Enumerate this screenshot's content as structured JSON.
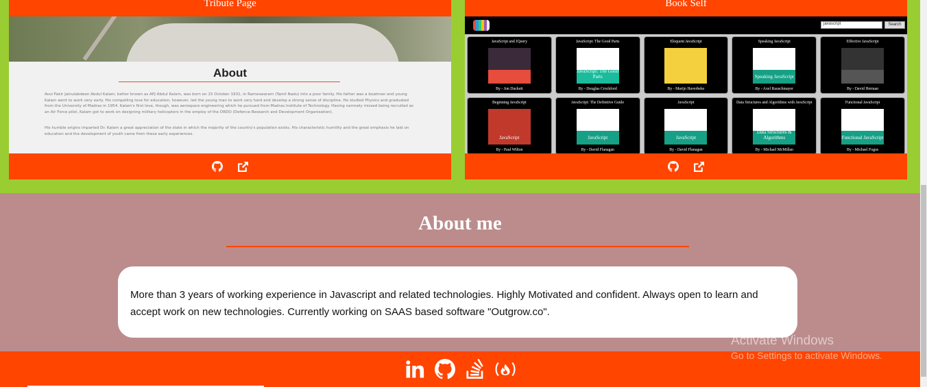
{
  "projects": [
    {
      "title": "Tribute Page",
      "preview": {
        "heading": "About",
        "paragraphs": [
          "Avul Pakir Jainulabdeen Abdul Kalam, better known as APJ Abdul Kalam, was born on 15 October 1931, in Rameswaram (Tamil Nadu) into a poor family. His father was a boatman and young Kalam went to work very early. His compelling love for education, however, led the young man to work very hard and develop a strong sense of discipline. He studied Physics and graduated from the University of Madras in 1954. Kalam's first love, though, was aerospace engineering which he pursued from Madras Institute of Technology. Having narrowly missed being recruited as an Air Force pilot, Kalam got to work on designing military helicopters in the employ of the DRDO (Defence Research and Development Organisation).",
          "His humble origins imparted Dr. Kalam a great appreciation of the state in which the majority of the country's population exists. His characteristic humility and the great emphasis he laid on education and the development of youth came from these early experiences."
        ]
      },
      "links": [
        "github-icon",
        "external-link-icon"
      ]
    },
    {
      "title": "Book Self",
      "preview": {
        "search_value": "javascript",
        "search_button": "Search",
        "books": [
          {
            "title": "JavaScript and JQuery",
            "author": "By - Jon Duckett",
            "cover": "#3a2a3a",
            "accent": "#e74c3c"
          },
          {
            "title": "JavaScript: The Good Parts",
            "author": "By - Douglas Crockford",
            "cover": "#ffffff",
            "accent": "#1abc9c",
            "label": "JavaScript: The Good Parts"
          },
          {
            "title": "Eloquent JavaScript",
            "author": "By - Marijn Haverbeke",
            "cover": "#f4d03f",
            "accent": "#f4d03f"
          },
          {
            "title": "Speaking JavaScript",
            "author": "By - Axel Rauschmayer",
            "cover": "#ffffff",
            "accent": "#16a085",
            "label": "Speaking JavaScript"
          },
          {
            "title": "Effective JavaScript",
            "author": "By - David Herman",
            "cover": "#333333",
            "accent": "#555555"
          },
          {
            "title": "Beginning JavaScript",
            "author": "By - Paul Wilton",
            "cover": "#c0392b",
            "accent": "#c0392b",
            "label": "JavaScript"
          },
          {
            "title": "JavaScript: The Definitive Guide",
            "author": "By - David Flanagan",
            "cover": "#ffffff",
            "accent": "#16a085",
            "label": "JavaScript"
          },
          {
            "title": "JavaScript",
            "author": "By - David Flanagan",
            "cover": "#ffffff",
            "accent": "#16a085",
            "label": "JavaScript"
          },
          {
            "title": "Data Structures and Algorithms with JavaScript",
            "author": "By - Michael McMillan",
            "cover": "#ffffff",
            "accent": "#16a085",
            "label": "Data Structures & Algorithms"
          },
          {
            "title": "Functional JavaScript",
            "author": "By - Michael Fogus",
            "cover": "#ffffff",
            "accent": "#16a085",
            "label": "Functional JavaScript"
          }
        ]
      },
      "links": [
        "github-icon",
        "external-link-icon"
      ]
    }
  ],
  "about": {
    "title": "About me",
    "text": "More than 3 years of working experience in Javascript and related technologies. Highly Motivated and confident. Always open to learn and accept work on new technologies. Currently working on SAAS based software \"Outgrow.co\"."
  },
  "footer": {
    "icons": [
      "linkedin-icon",
      "github-icon",
      "stackoverflow-icon",
      "freecodecamp-icon"
    ]
  },
  "watermark": {
    "line1": "Activate Windows",
    "line2": "Go to Settings to activate Windows."
  },
  "colors": {
    "accent": "#ff4500",
    "projects_bg": "#9acd32",
    "about_bg": "#bc8c8c"
  }
}
